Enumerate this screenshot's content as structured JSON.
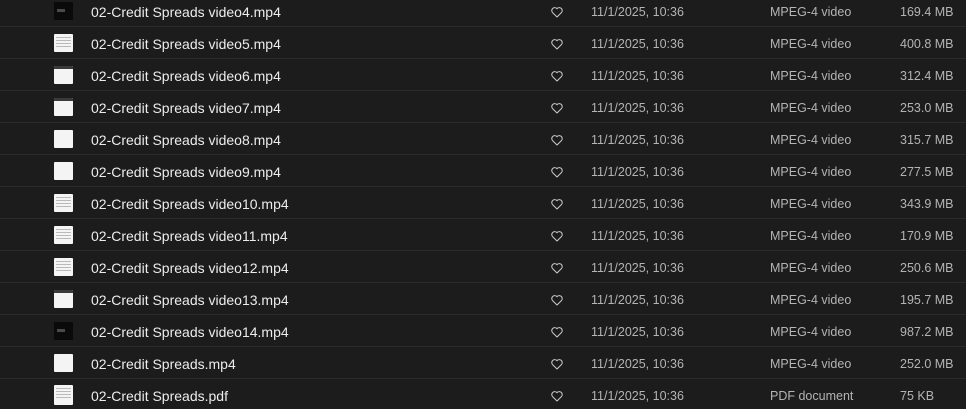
{
  "files": [
    {
      "name": "02-Credit Spreads video4.mp4",
      "modified": "11/1/2025, 10:36",
      "kind": "MPEG-4 video",
      "size": "169.4 MB",
      "thumb_icon": "video-thumbnail-icon"
    },
    {
      "name": "02-Credit Spreads video5.mp4",
      "modified": "11/1/2025, 10:36",
      "kind": "MPEG-4 video",
      "size": "400.8 MB",
      "thumb_icon": "video-thumbnail-icon"
    },
    {
      "name": "02-Credit Spreads video6.mp4",
      "modified": "11/1/2025, 10:36",
      "kind": "MPEG-4 video",
      "size": "312.4 MB",
      "thumb_icon": "video-thumbnail-icon"
    },
    {
      "name": "02-Credit Spreads video7.mp4",
      "modified": "11/1/2025, 10:36",
      "kind": "MPEG-4 video",
      "size": "253.0 MB",
      "thumb_icon": "video-thumbnail-icon"
    },
    {
      "name": "02-Credit Spreads video8.mp4",
      "modified": "11/1/2025, 10:36",
      "kind": "MPEG-4 video",
      "size": "315.7 MB",
      "thumb_icon": "video-thumbnail-icon"
    },
    {
      "name": "02-Credit Spreads video9.mp4",
      "modified": "11/1/2025, 10:36",
      "kind": "MPEG-4 video",
      "size": "277.5 MB",
      "thumb_icon": "video-thumbnail-icon"
    },
    {
      "name": "02-Credit Spreads video10.mp4",
      "modified": "11/1/2025, 10:36",
      "kind": "MPEG-4 video",
      "size": "343.9 MB",
      "thumb_icon": "video-thumbnail-icon"
    },
    {
      "name": "02-Credit Spreads video11.mp4",
      "modified": "11/1/2025, 10:36",
      "kind": "MPEG-4 video",
      "size": "170.9 MB",
      "thumb_icon": "video-thumbnail-icon"
    },
    {
      "name": "02-Credit Spreads video12.mp4",
      "modified": "11/1/2025, 10:36",
      "kind": "MPEG-4 video",
      "size": "250.6 MB",
      "thumb_icon": "video-thumbnail-icon"
    },
    {
      "name": "02-Credit Spreads video13.mp4",
      "modified": "11/1/2025, 10:36",
      "kind": "MPEG-4 video",
      "size": "195.7 MB",
      "thumb_icon": "video-thumbnail-icon"
    },
    {
      "name": "02-Credit Spreads video14.mp4",
      "modified": "11/1/2025, 10:36",
      "kind": "MPEG-4 video",
      "size": "987.2 MB",
      "thumb_icon": "video-thumbnail-icon"
    },
    {
      "name": "02-Credit Spreads.mp4",
      "modified": "11/1/2025, 10:36",
      "kind": "MPEG-4 video",
      "size": "252.0 MB",
      "thumb_icon": "video-thumbnail-icon"
    },
    {
      "name": "02-Credit Spreads.pdf",
      "modified": "11/1/2025, 10:36",
      "kind": "PDF document",
      "size": "75 KB",
      "thumb_icon": "pdf-thumbnail-icon"
    }
  ],
  "favorite_icon": "heart-outline-icon",
  "colors": {
    "background": "#1c1c1c",
    "row_divider": "#2c2c2c",
    "name_text": "#ececec",
    "meta_text": "#b4b4b4"
  }
}
